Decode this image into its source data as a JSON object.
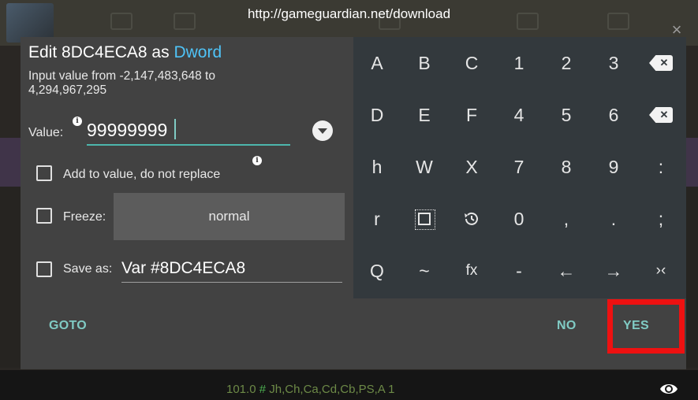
{
  "background": {
    "url_text": "http://gameguardian.net/download",
    "status_number": "101.0",
    "status_hash": "#",
    "status_flags": "Jh,Ch,Ca,Cd,Cb,PS,A 1"
  },
  "dialog": {
    "title_prefix": "Edit 8DC4ECA8 as",
    "title_type": "Dword",
    "range_hint": "Input value from -2,147,483,648 to 4,294,967,295",
    "value_label": "Value:",
    "value": "99999999",
    "add_to_value_label": "Add to value, do not replace",
    "freeze_label": "Freeze:",
    "freeze_mode": "normal",
    "save_as_label": "Save as:",
    "save_as_value": "Var #8DC4ECA8",
    "buttons": {
      "goto": "GOTO",
      "no": "NO",
      "yes": "YES"
    }
  },
  "keypad": {
    "rows": [
      [
        "A",
        "B",
        "C",
        "1",
        "2",
        "3",
        "backspace-icon"
      ],
      [
        "D",
        "E",
        "F",
        "4",
        "5",
        "6",
        "clear-icon"
      ],
      [
        "h",
        "W",
        "X",
        "7",
        "8",
        "9",
        ":"
      ],
      [
        "r",
        "select-icon",
        "history-icon",
        "0",
        ",",
        ".",
        ";"
      ],
      [
        "Q",
        "~",
        "fx",
        "-",
        "←",
        "→",
        "›‹"
      ]
    ]
  },
  "colors": {
    "accent": "#80cbc4",
    "type_highlight": "#4fc3f7",
    "highlight_box": "#ee1111",
    "dialog_bg": "#424242",
    "keypad_bg": "#33393d"
  }
}
